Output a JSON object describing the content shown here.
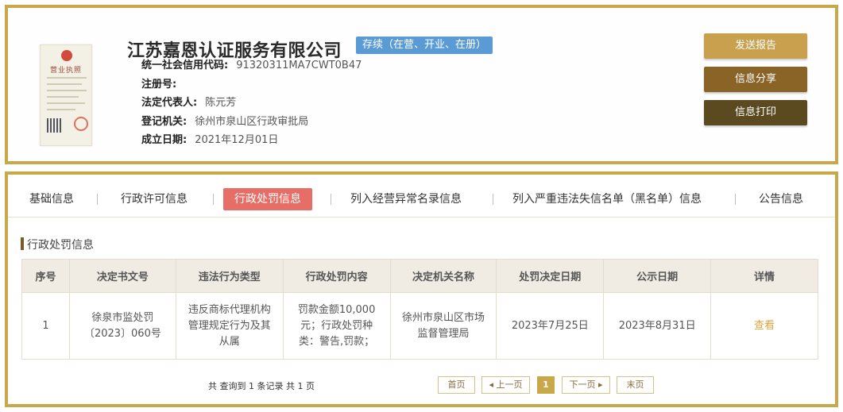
{
  "company": {
    "name": "江苏嘉恩认证服务有限公司",
    "status": "存续（在营、开业、在册）",
    "license_image": {
      "title": "营业执照"
    },
    "fields": [
      {
        "label": "统一社会信用代码:",
        "value": "91320311MA7CWT0B47"
      },
      {
        "label": "注册号:",
        "value": ""
      },
      {
        "label": "法定代表人:",
        "value": "陈元芳"
      },
      {
        "label": "登记机关:",
        "value": "徐州市泉山区行政审批局"
      },
      {
        "label": "成立日期:",
        "value": "2021年12月01日"
      }
    ]
  },
  "actions": {
    "send_report": "发送报告",
    "share": "信息分享",
    "print": "信息打印"
  },
  "tabs": [
    "基础信息",
    "行政许可信息",
    "行政处罚信息",
    "列入经营异常名录信息",
    "列入严重违法失信名单（黑名单）信息",
    "公告信息"
  ],
  "active_tab": "行政处罚信息",
  "section": {
    "title": "行政处罚信息"
  },
  "table": {
    "headers": [
      "序号",
      "决定书文号",
      "违法行为类型",
      "行政处罚内容",
      "决定机关名称",
      "处罚决定日期",
      "公示日期",
      "详情"
    ],
    "rows": [
      [
        "1",
        "徐泉市监处罚〔2023〕060号",
        "违反商标代理机构管理规定行为及其从属",
        "罚款金额10,000元；行政处罚种类：警告,罚款；",
        "徐州市泉山区市场监督管理局",
        "2023年7月25日",
        "2023年8月31日",
        "查看"
      ]
    ]
  },
  "pagination": {
    "summary": "共 查询到 1 条记录 共 1 页",
    "first": "首页",
    "prev": "上一页",
    "current": "1",
    "next": "下一页",
    "last": "末页"
  },
  "colors": {
    "frame": "#c9a84a",
    "status_badge": "#5b9bd5",
    "active_tab": "#e76e66",
    "btn_send": "#c9a04e",
    "btn_share": "#8a6326",
    "btn_print": "#5b4a1f",
    "detail_link": "#e3a33b"
  }
}
